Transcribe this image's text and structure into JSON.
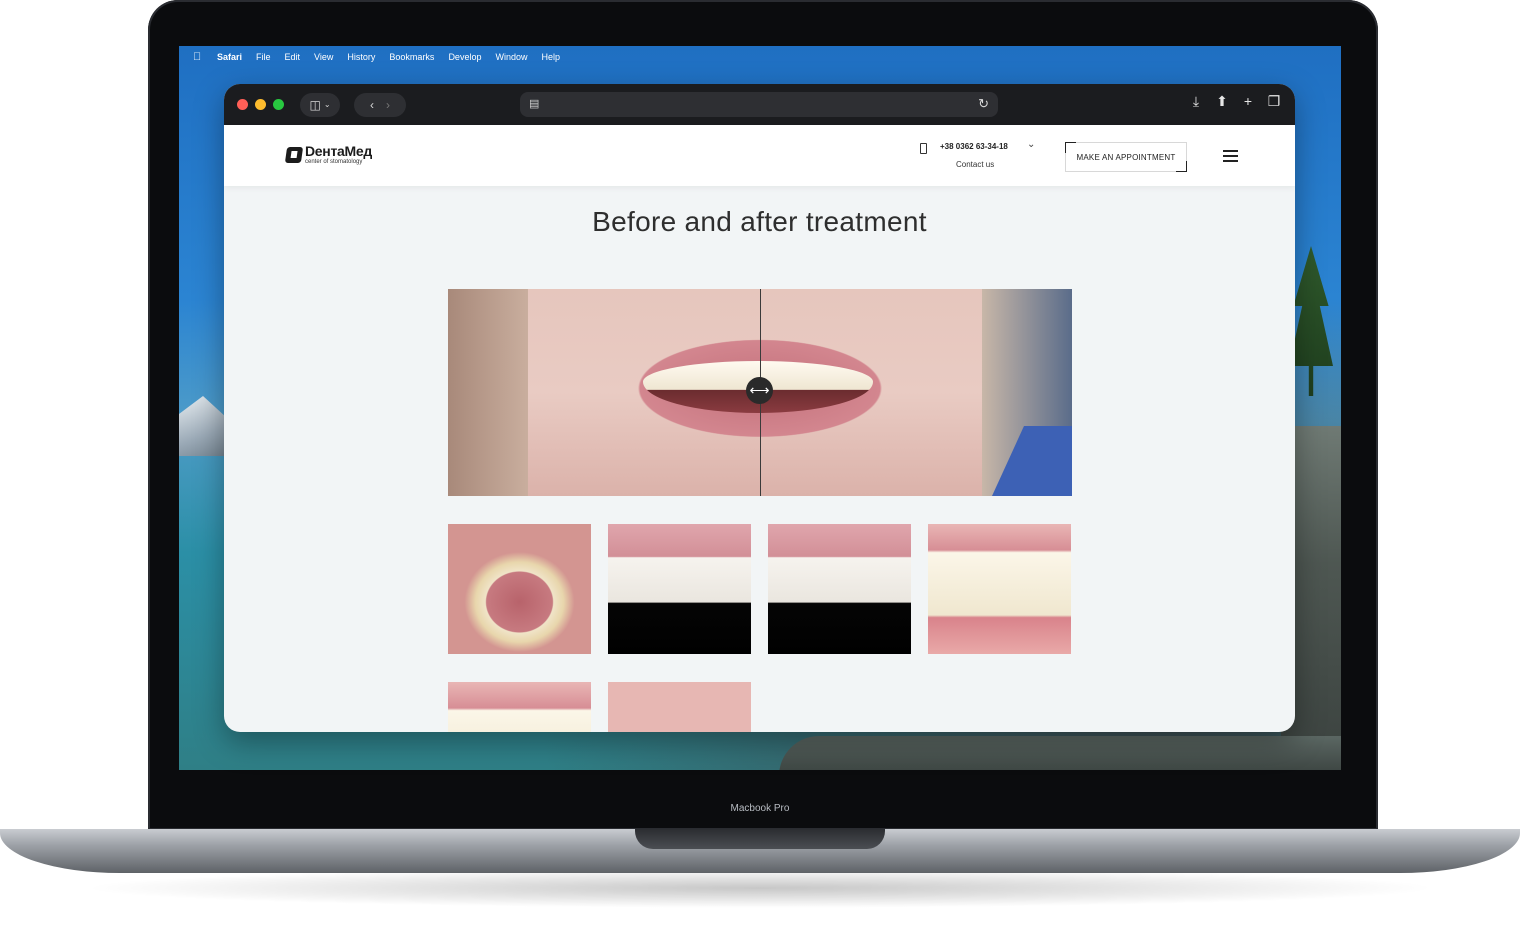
{
  "menubar": {
    "items": [
      "Safari",
      "File",
      "Edit",
      "View",
      "History",
      "Bookmarks",
      "Develop",
      "Window",
      "Help"
    ]
  },
  "device": {
    "label": "Macbook Pro"
  },
  "site": {
    "logo": {
      "name": "DентаMед",
      "tagline": "center of stomatology"
    },
    "phone": "+38 0362 63-34-18",
    "contact_label": "Contact us",
    "appointment_label": "MAKE AN APPOINTMENT",
    "section_title": "Before and after treatment"
  },
  "colors": {
    "toolbar_bg": "#1b1c1f",
    "page_bg": "#f2f5f6",
    "header_bg": "#ffffff",
    "text_dark": "#2e2e2e"
  },
  "icons": {
    "apple": "apple-icon",
    "sidebar": "sidebar-icon",
    "back": "chevron-left-icon",
    "forward": "chevron-right-icon",
    "reload": "reload-icon",
    "download": "download-icon",
    "share": "share-icon",
    "new_tab": "plus-icon",
    "tabs": "tabs-overview-icon",
    "phone": "phone-icon",
    "menu": "hamburger-icon",
    "slider_handle": "compare-handle-icon"
  }
}
